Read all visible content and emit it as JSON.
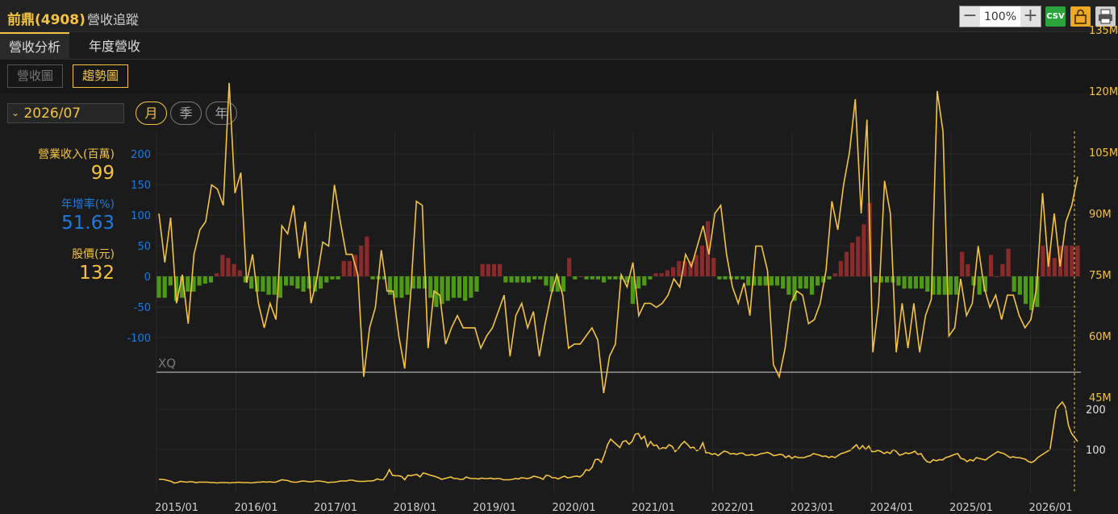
{
  "header": {
    "stock_name": "前鼎(4908)",
    "tool_name": "營收追蹤",
    "zoom_level": "100%",
    "csv_label": "CSV"
  },
  "tabs": [
    {
      "label": "營收分析",
      "active": true
    },
    {
      "label": "年度營收",
      "active": false
    }
  ],
  "view_buttons": {
    "revenue_chart": "營收圖",
    "trend_chart": "趨勢圖",
    "active": "趨勢圖"
  },
  "period": {
    "value": "2026/07",
    "icon": "chevron-down-icon"
  },
  "frequency": [
    {
      "label": "月",
      "active": true
    },
    {
      "label": "季",
      "active": false
    },
    {
      "label": "年",
      "active": false
    }
  ],
  "summary": {
    "revenue_label": "營業收入(百萬)",
    "revenue_value": "99",
    "yoy_label": "年增率(%)",
    "yoy_value": "51.63",
    "price_label": "股價(元)",
    "price_value": "132"
  },
  "colors": {
    "revenue_line": "#f5c342",
    "yoy_positive": "#8b2a2a",
    "yoy_negative": "#4e9a17",
    "yoy_text": "#1e7ae0",
    "accent": "#f5c342"
  },
  "chart_data": [
    {
      "type": "bar+line",
      "left_axis": {
        "ticks": [
          "200",
          "150",
          "100",
          "50",
          "0",
          "-50",
          "-100"
        ],
        "range": [
          -100,
          200
        ]
      },
      "right_axis": {
        "ticks": [
          "135M",
          "120M",
          "105M",
          "90M",
          "75M",
          "60M",
          "45M"
        ],
        "range": [
          45,
          135
        ]
      },
      "x_ticks": [
        "2015/01",
        "2016/01",
        "2017/01",
        "2018/01",
        "2019/01",
        "2020/01",
        "2021/01",
        "2022/01",
        "2023/01",
        "2024/01",
        "2025/01",
        "2026/01"
      ],
      "watermark": "XQ",
      "series": [
        {
          "name": "年增率(%)",
          "axis": "left",
          "values": [
            -35,
            -35,
            -15,
            -40,
            -35,
            -25,
            -25,
            -15,
            -12,
            -10,
            5,
            35,
            30,
            20,
            10,
            -10,
            -20,
            -25,
            -25,
            -30,
            -30,
            -35,
            -15,
            -15,
            -20,
            -25,
            -20,
            -25,
            -20,
            -10,
            -5,
            -5,
            25,
            25,
            35,
            50,
            65,
            -5,
            -5,
            -5,
            -30,
            -35,
            -35,
            -30,
            -20,
            -20,
            -20,
            -35,
            -50,
            -45,
            -40,
            -35,
            -35,
            -40,
            -35,
            -25,
            20,
            20,
            20,
            20,
            -10,
            -10,
            -10,
            -10,
            -10,
            -5,
            -5,
            -15,
            -25,
            -25,
            -25,
            30,
            -5,
            0,
            -5,
            -5,
            -5,
            -10,
            -5,
            -5,
            -5,
            -10,
            -45,
            -20,
            -15,
            -5,
            5,
            5,
            10,
            15,
            25,
            25,
            25,
            35,
            50,
            90,
            30,
            -5,
            -5,
            -5,
            -5,
            -5,
            -15,
            -15,
            -15,
            -15,
            -15,
            -15,
            -20,
            -30,
            -40,
            -20,
            -20,
            -30,
            -15,
            -10,
            -5,
            5,
            25,
            40,
            55,
            65,
            85,
            120,
            -10,
            -10,
            -10,
            -10,
            -15,
            -20,
            -20,
            -20,
            -20,
            -25,
            -30,
            -30,
            -30,
            -30,
            -30,
            40,
            20,
            -15,
            -30,
            -25,
            35,
            0,
            20,
            45,
            -25,
            -30,
            -45,
            -55,
            -50,
            50,
            40,
            30,
            50,
            50,
            50,
            50
          ]
        },
        {
          "name": "營業收入",
          "axis": "right",
          "unit": "M",
          "values": [
            90,
            78,
            89,
            68,
            75,
            63,
            80,
            86,
            88,
            97,
            96,
            92,
            122,
            95,
            100,
            73,
            80,
            68,
            62,
            68,
            64,
            87,
            85,
            92,
            79,
            88,
            68,
            74,
            83,
            82,
            97,
            88,
            80,
            80,
            75,
            50,
            62,
            67,
            81,
            71,
            71,
            60,
            52,
            70,
            93,
            92,
            57,
            71,
            70,
            58,
            62,
            65,
            62,
            62,
            62,
            57,
            60,
            62,
            66,
            70,
            55,
            65,
            68,
            62,
            66,
            55,
            63,
            70,
            75,
            70,
            57,
            58,
            58,
            60,
            62,
            59,
            46,
            55,
            58,
            75,
            72,
            78,
            65,
            68,
            68,
            67,
            68,
            70,
            74,
            72,
            80,
            77,
            82,
            87,
            80,
            90,
            92,
            80,
            72,
            68,
            73,
            65,
            82,
            82,
            76,
            53,
            50,
            57,
            68,
            71,
            70,
            63,
            64,
            68,
            76,
            93,
            86,
            97,
            105,
            118,
            90,
            113,
            56,
            68,
            98,
            90,
            56,
            68,
            57,
            68,
            56,
            65,
            69,
            120,
            110,
            60,
            62,
            74,
            65,
            68,
            82,
            72,
            67,
            70,
            64,
            70,
            70,
            65,
            62,
            64,
            72,
            95,
            77,
            90,
            77,
            88,
            92,
            99
          ]
        }
      ]
    },
    {
      "type": "line",
      "right_axis": {
        "ticks": [
          "200",
          "100"
        ]
      },
      "series": [
        {
          "name": "股價(元)",
          "values": [
            26,
            26,
            25,
            23,
            21,
            17,
            18,
            21,
            20,
            19,
            20,
            20,
            18,
            19,
            19,
            19,
            19,
            18,
            18,
            17,
            18,
            18,
            18,
            17,
            18,
            18,
            19,
            18,
            18,
            18,
            17,
            18,
            19,
            19,
            20,
            19,
            20,
            19,
            19,
            22,
            25,
            24,
            23,
            20,
            19,
            19,
            21,
            22,
            21,
            20,
            20,
            22,
            22,
            21,
            20,
            18,
            19,
            19,
            20,
            22,
            22,
            22,
            24,
            24,
            22,
            21,
            21,
            21,
            22,
            22,
            23,
            27,
            25,
            25,
            35,
            50,
            36,
            35,
            35,
            33,
            25,
            36,
            35,
            37,
            38,
            32,
            42,
            40,
            37,
            35,
            33,
            30,
            26,
            28,
            30,
            32,
            28,
            28,
            26,
            26,
            32,
            29,
            28,
            28,
            27,
            29,
            28,
            28,
            29,
            27,
            28,
            28,
            25,
            25,
            25,
            26,
            28,
            27,
            30,
            29,
            28,
            30,
            34,
            32,
            30,
            26,
            36,
            35,
            30,
            30,
            27,
            31,
            34,
            30,
            31,
            33,
            34,
            32,
            38,
            50,
            48,
            56,
            75,
            76,
            68,
            88,
            112,
            126,
            119,
            112,
            105,
            120,
            122,
            113,
            120,
            138,
            140,
            126,
            133,
            107,
            120,
            110,
            111,
            100,
            105,
            103,
            112,
            108,
            95,
            102,
            113,
            120,
            113,
            104,
            106,
            97,
            101,
            117,
            92,
            92,
            88,
            90,
            85,
            91,
            96,
            94,
            89,
            90,
            88,
            91,
            91,
            86,
            86,
            88,
            85,
            87,
            90,
            91,
            93,
            90,
            85,
            86,
            88,
            87,
            80,
            85,
            78,
            83,
            80,
            80,
            80,
            83,
            85,
            90,
            88,
            86,
            83,
            84,
            80,
            83,
            80,
            85,
            90,
            92,
            95,
            98,
            105,
            112,
            100,
            110,
            100,
            109,
            95,
            95,
            98,
            95,
            90,
            94,
            90,
            100,
            95,
            86,
            88,
            92,
            90,
            92,
            96,
            88,
            90,
            78,
            70,
            68,
            75,
            72,
            75,
            74,
            80,
            82,
            85,
            88,
            90,
            78,
            76,
            70,
            75,
            72,
            80,
            78,
            76,
            74,
            80,
            85,
            90,
            95,
            92,
            90,
            85,
            80,
            82,
            80,
            80,
            78,
            76,
            70,
            68,
            72,
            80,
            85,
            90,
            95,
            100,
            150,
            200,
            210,
            218,
            205,
            160,
            140,
            130,
            120
          ]
        }
      ]
    }
  ]
}
